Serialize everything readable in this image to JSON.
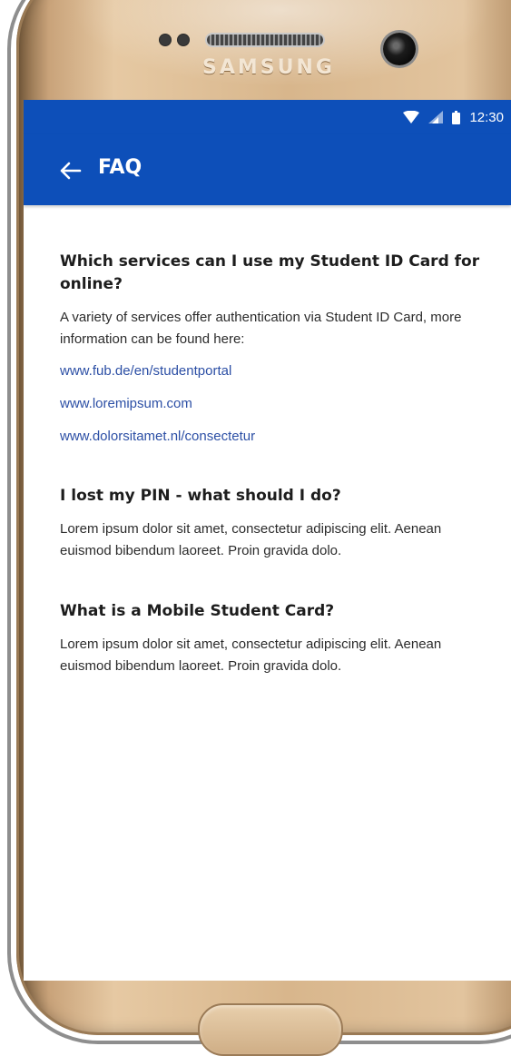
{
  "device": {
    "brand": "SAMSUNG"
  },
  "status_bar": {
    "time": "12:30",
    "icons": [
      "wifi-icon",
      "signal-icon",
      "battery-icon"
    ]
  },
  "app_bar": {
    "title": "FAQ",
    "back_icon": "arrow-left-icon"
  },
  "faq": [
    {
      "question": "Which services can I use my Student ID Card for online?",
      "answer": "A variety of services offer authentication via Student ID Card, more information can be found here:",
      "links": [
        "www.fub.de/en/studentportal",
        "www.loremipsum.com",
        "www.dolorsitamet.nl/consectetur"
      ]
    },
    {
      "question": "I lost my PIN - what should I do?",
      "answer": "Lorem ipsum dolor sit amet, consectetur adipiscing elit. Aenean euismod bibendum laoreet. Proin gravida dolo."
    },
    {
      "question": "What is a Mobile Student Card?",
      "answer": "Lorem ipsum dolor sit amet, consectetur adipiscing elit. Aenean euismod bibendum laoreet. Proin gravida dolo."
    }
  ],
  "colors": {
    "app_bar": "#0d4fb9",
    "link": "#2c4fa5",
    "text": "#1d1d1d"
  }
}
